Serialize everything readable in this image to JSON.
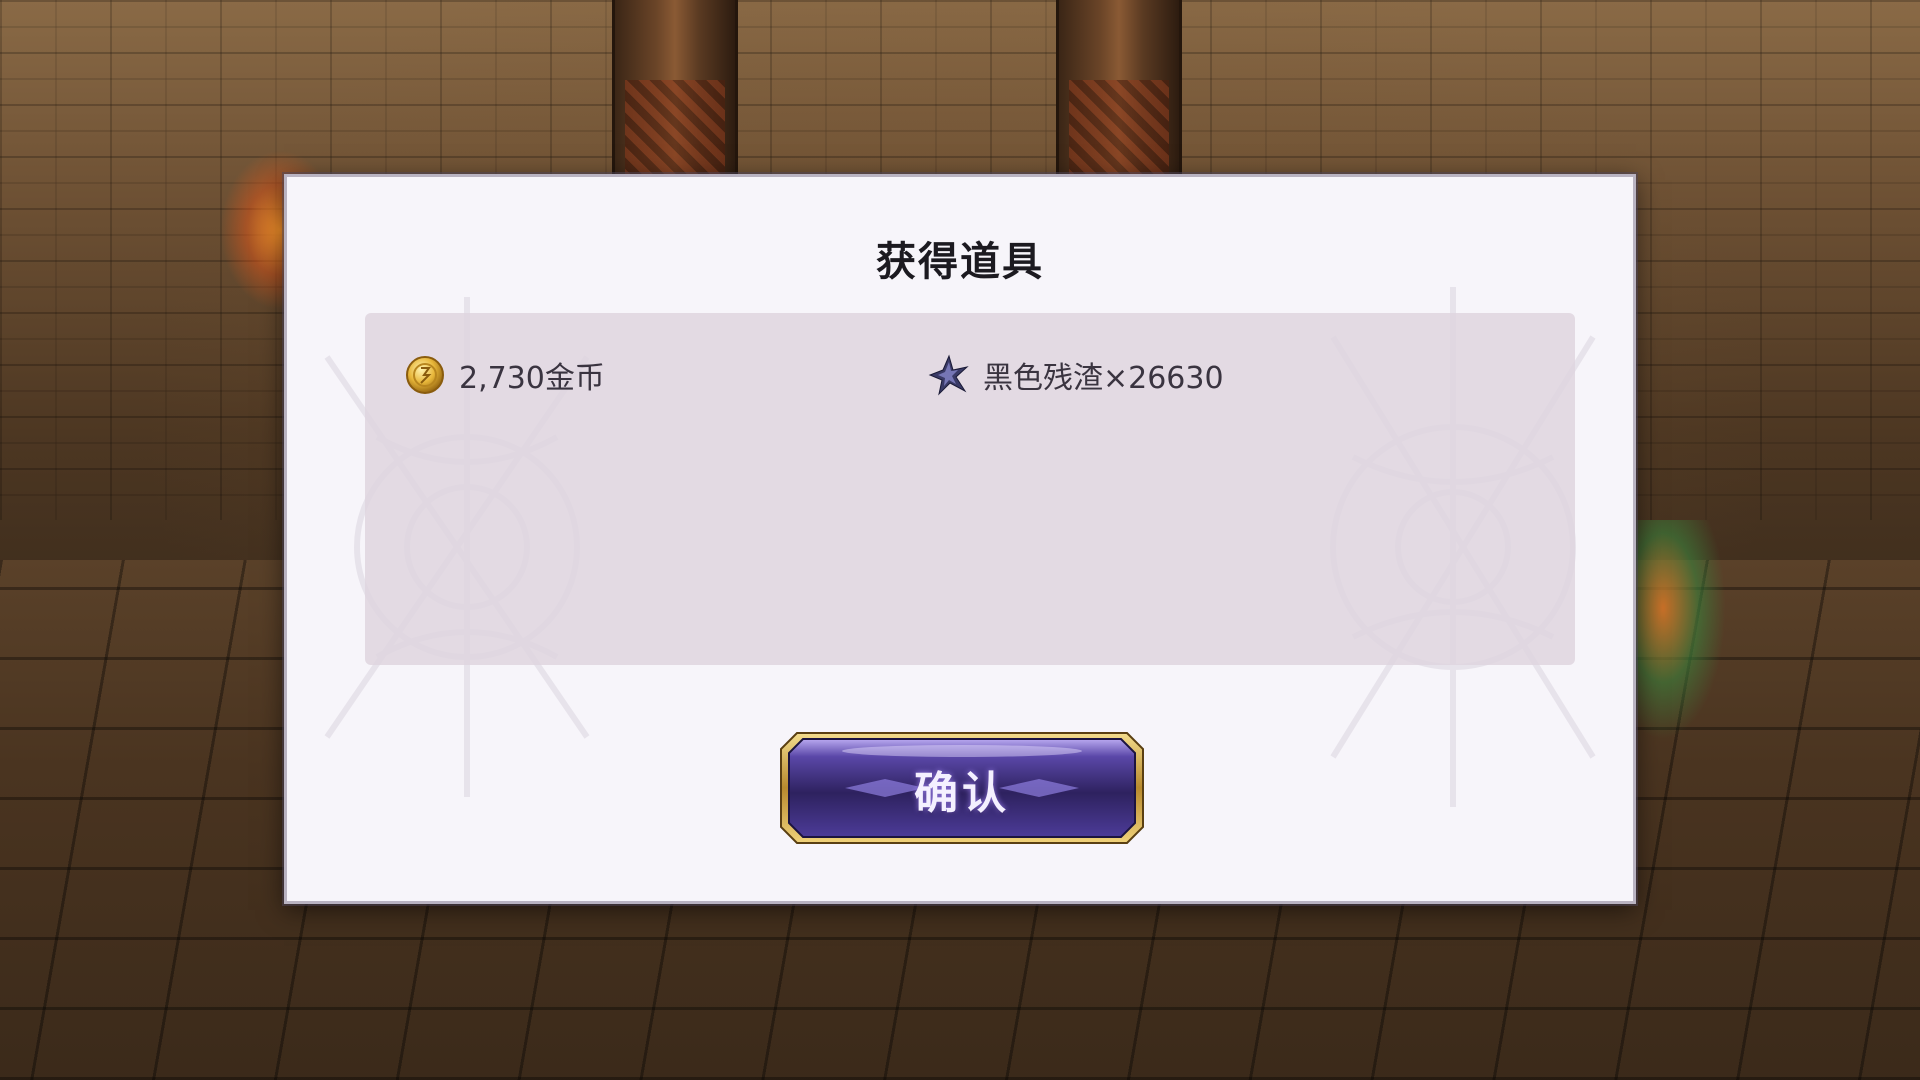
{
  "dialog": {
    "title": "获得道具",
    "rewards": [
      {
        "icon": "gold-coin-icon",
        "label": "2,730金币"
      },
      {
        "icon": "black-residue-icon",
        "label": "黑色残渣×26630"
      }
    ],
    "confirm_label": "确认"
  },
  "colors": {
    "dialog_bg": "#f7f5fa",
    "panel_bg": "#ded4de",
    "button_purple": "#3d2f7a",
    "button_gold": "#c9a24a"
  }
}
